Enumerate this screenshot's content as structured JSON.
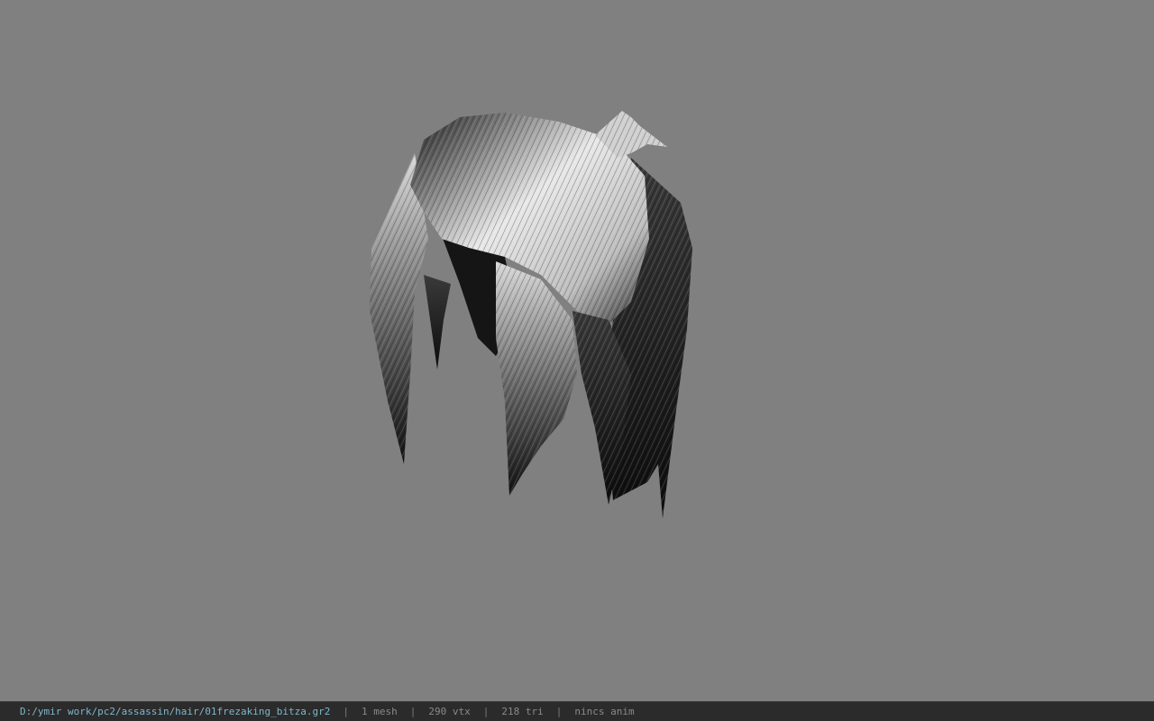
{
  "viewer": {
    "background_color": "#808080",
    "model_icon": "hair-mesh"
  },
  "status_bar": {
    "file_path": "D:/ymir work/pc2/assassin/hair/01frezaking_bitza.gr2",
    "separator": "|",
    "mesh_count": "1 mesh",
    "vertex_count": "290 vtx",
    "triangle_count": "218 tri",
    "anim_status": "nincs anim",
    "path_color": "#7fb6cc"
  }
}
